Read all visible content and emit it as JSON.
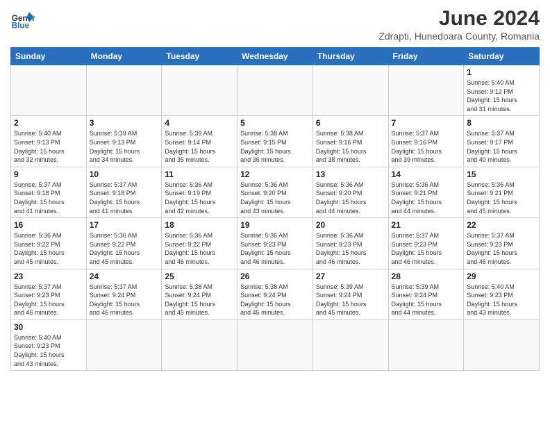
{
  "header": {
    "logo_general": "General",
    "logo_blue": "Blue",
    "month_year": "June 2024",
    "location": "Zdrapti, Hunedoara County, Romania"
  },
  "days_of_week": [
    "Sunday",
    "Monday",
    "Tuesday",
    "Wednesday",
    "Thursday",
    "Friday",
    "Saturday"
  ],
  "weeks": [
    [
      {
        "day": "",
        "info": ""
      },
      {
        "day": "",
        "info": ""
      },
      {
        "day": "",
        "info": ""
      },
      {
        "day": "",
        "info": ""
      },
      {
        "day": "",
        "info": ""
      },
      {
        "day": "",
        "info": ""
      },
      {
        "day": "1",
        "info": "Sunrise: 5:40 AM\nSunset: 9:12 PM\nDaylight: 15 hours\nand 31 minutes."
      }
    ],
    [
      {
        "day": "2",
        "info": "Sunrise: 5:40 AM\nSunset: 9:13 PM\nDaylight: 15 hours\nand 32 minutes."
      },
      {
        "day": "3",
        "info": "Sunrise: 5:39 AM\nSunset: 9:13 PM\nDaylight: 15 hours\nand 34 minutes."
      },
      {
        "day": "4",
        "info": "Sunrise: 5:39 AM\nSunset: 9:14 PM\nDaylight: 15 hours\nand 35 minutes."
      },
      {
        "day": "5",
        "info": "Sunrise: 5:38 AM\nSunset: 9:15 PM\nDaylight: 15 hours\nand 36 minutes."
      },
      {
        "day": "6",
        "info": "Sunrise: 5:38 AM\nSunset: 9:16 PM\nDaylight: 15 hours\nand 38 minutes."
      },
      {
        "day": "7",
        "info": "Sunrise: 5:37 AM\nSunset: 9:16 PM\nDaylight: 15 hours\nand 39 minutes."
      },
      {
        "day": "8",
        "info": "Sunrise: 5:37 AM\nSunset: 9:17 PM\nDaylight: 15 hours\nand 40 minutes."
      }
    ],
    [
      {
        "day": "9",
        "info": "Sunrise: 5:37 AM\nSunset: 9:18 PM\nDaylight: 15 hours\nand 41 minutes."
      },
      {
        "day": "10",
        "info": "Sunrise: 5:37 AM\nSunset: 9:18 PM\nDaylight: 15 hours\nand 41 minutes."
      },
      {
        "day": "11",
        "info": "Sunrise: 5:36 AM\nSunset: 9:19 PM\nDaylight: 15 hours\nand 42 minutes."
      },
      {
        "day": "12",
        "info": "Sunrise: 5:36 AM\nSunset: 9:20 PM\nDaylight: 15 hours\nand 43 minutes."
      },
      {
        "day": "13",
        "info": "Sunrise: 5:36 AM\nSunset: 9:20 PM\nDaylight: 15 hours\nand 44 minutes."
      },
      {
        "day": "14",
        "info": "Sunrise: 5:36 AM\nSunset: 9:21 PM\nDaylight: 15 hours\nand 44 minutes."
      },
      {
        "day": "15",
        "info": "Sunrise: 5:36 AM\nSunset: 9:21 PM\nDaylight: 15 hours\nand 45 minutes."
      }
    ],
    [
      {
        "day": "16",
        "info": "Sunrise: 5:36 AM\nSunset: 9:22 PM\nDaylight: 15 hours\nand 45 minutes."
      },
      {
        "day": "17",
        "info": "Sunrise: 5:36 AM\nSunset: 9:22 PM\nDaylight: 15 hours\nand 45 minutes."
      },
      {
        "day": "18",
        "info": "Sunrise: 5:36 AM\nSunset: 9:22 PM\nDaylight: 15 hours\nand 46 minutes."
      },
      {
        "day": "19",
        "info": "Sunrise: 5:36 AM\nSunset: 9:23 PM\nDaylight: 15 hours\nand 46 minutes."
      },
      {
        "day": "20",
        "info": "Sunrise: 5:36 AM\nSunset: 9:23 PM\nDaylight: 15 hours\nand 46 minutes."
      },
      {
        "day": "21",
        "info": "Sunrise: 5:37 AM\nSunset: 9:23 PM\nDaylight: 15 hours\nand 46 minutes."
      },
      {
        "day": "22",
        "info": "Sunrise: 5:37 AM\nSunset: 9:23 PM\nDaylight: 15 hours\nand 46 minutes."
      }
    ],
    [
      {
        "day": "23",
        "info": "Sunrise: 5:37 AM\nSunset: 9:23 PM\nDaylight: 15 hours\nand 46 minutes."
      },
      {
        "day": "24",
        "info": "Sunrise: 5:37 AM\nSunset: 9:24 PM\nDaylight: 15 hours\nand 46 minutes."
      },
      {
        "day": "25",
        "info": "Sunrise: 5:38 AM\nSunset: 9:24 PM\nDaylight: 15 hours\nand 45 minutes."
      },
      {
        "day": "26",
        "info": "Sunrise: 5:38 AM\nSunset: 9:24 PM\nDaylight: 15 hours\nand 45 minutes."
      },
      {
        "day": "27",
        "info": "Sunrise: 5:39 AM\nSunset: 9:24 PM\nDaylight: 15 hours\nand 45 minutes."
      },
      {
        "day": "28",
        "info": "Sunrise: 5:39 AM\nSunset: 9:24 PM\nDaylight: 15 hours\nand 44 minutes."
      },
      {
        "day": "29",
        "info": "Sunrise: 5:40 AM\nSunset: 9:23 PM\nDaylight: 15 hours\nand 43 minutes."
      }
    ],
    [
      {
        "day": "30",
        "info": "Sunrise: 5:40 AM\nSunset: 9:23 PM\nDaylight: 15 hours\nand 43 minutes."
      },
      {
        "day": "",
        "info": ""
      },
      {
        "day": "",
        "info": ""
      },
      {
        "day": "",
        "info": ""
      },
      {
        "day": "",
        "info": ""
      },
      {
        "day": "",
        "info": ""
      },
      {
        "day": "",
        "info": ""
      }
    ]
  ]
}
